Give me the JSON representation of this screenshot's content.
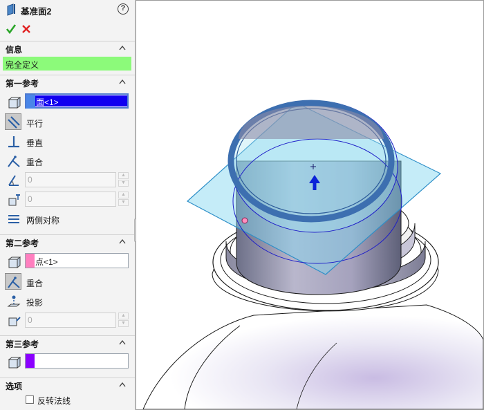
{
  "title": {
    "text": "基准面2",
    "help_label": "?"
  },
  "actions": {
    "ok_icon": "checkmark-icon",
    "cancel_icon": "x-icon"
  },
  "info_section": {
    "label": "信息",
    "status": "完全定义",
    "status_color": "#8cfa7a"
  },
  "first_ref": {
    "label": "第一参考",
    "selection": "面<1>",
    "selection_color": "#1000f0",
    "options": [
      {
        "label": "平行",
        "active": true
      },
      {
        "label": "垂直",
        "active": false
      },
      {
        "label": "重合",
        "active": false
      }
    ],
    "angle_value": "0",
    "distance_value": "0",
    "symmetric_label": "两侧对称"
  },
  "second_ref": {
    "label": "第二参考",
    "selection": "点<1>",
    "selection_color": "#ff7fbf",
    "options": [
      {
        "label": "重合",
        "active": true
      },
      {
        "label": "投影",
        "active": false
      }
    ],
    "value": "0"
  },
  "third_ref": {
    "label": "第三参考",
    "selection": "",
    "selection_color": "#8b00ff"
  },
  "options_section": {
    "label": "选项",
    "flip_normal_label": "反转法线",
    "flip_normal_checked": false
  }
}
